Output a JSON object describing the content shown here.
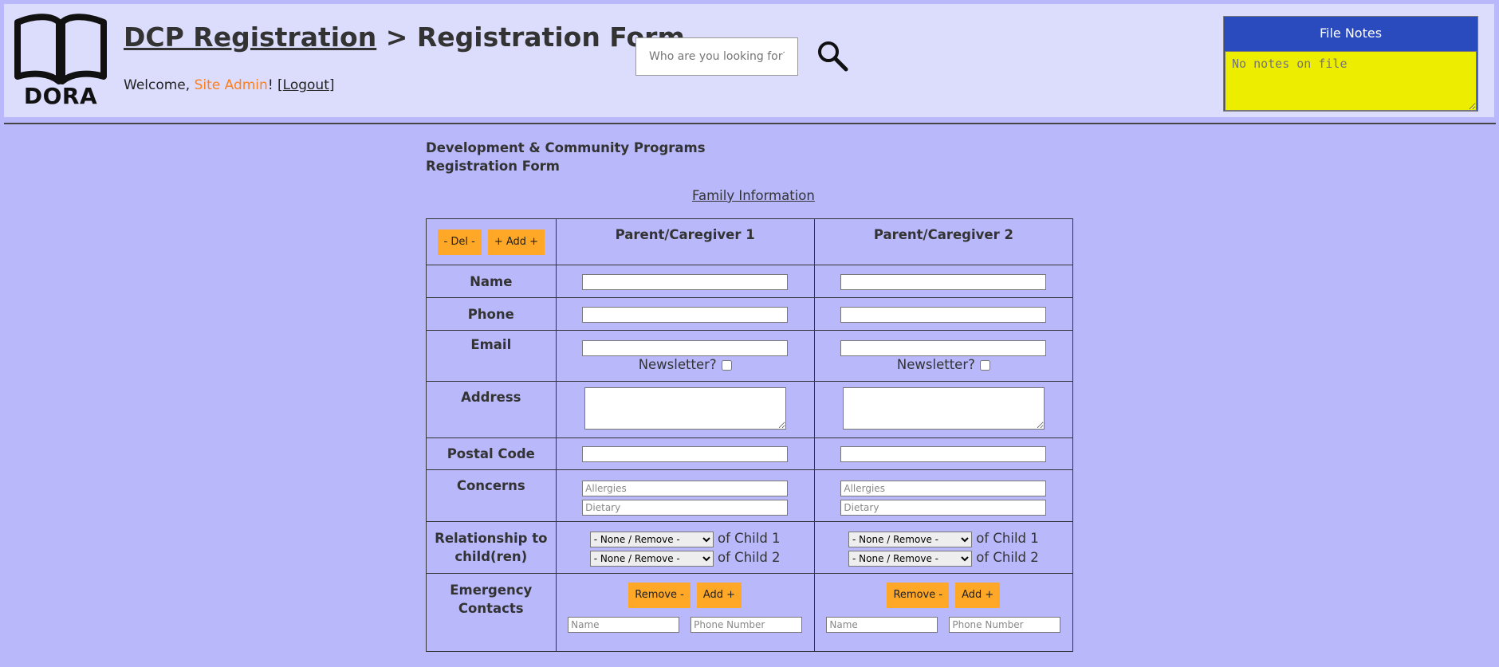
{
  "header": {
    "logo_text": "DORA",
    "breadcrumb_link": "DCP Registration",
    "breadcrumb_sep": " > ",
    "breadcrumb_current": "Registration Form",
    "welcome_prefix": "Welcome, ",
    "user_name": "Site Admin",
    "welcome_mid": "! [",
    "logout_label": "Logout",
    "welcome_suffix": "]",
    "search_placeholder": "Who are you looking for?",
    "search_icon": "search-icon"
  },
  "notes": {
    "title": "File Notes",
    "placeholder": "No notes on file"
  },
  "org": {
    "line1": "Development & Community Programs",
    "line2": "Registration Form"
  },
  "section_title": "Family Information",
  "table": {
    "del_label": "- Del -",
    "add_label": "+ Add +",
    "columns": [
      "Parent/Caregiver 1",
      "Parent/Caregiver 2"
    ],
    "rows": {
      "name": "Name",
      "phone": "Phone",
      "email": "Email",
      "address": "Address",
      "postal": "Postal Code",
      "concerns": "Concerns",
      "relationship": "Relationship to child(ren)",
      "emergency": "Emergency Contacts"
    },
    "newsletter_label": "Newsletter?",
    "allergies_placeholder": "Allergies",
    "dietary_placeholder": "Dietary",
    "relationship_option": "- None / Remove -",
    "of_child_1": "of Child 1",
    "of_child_2": "of Child 2",
    "remove_label": "Remove -",
    "add_contact_label": "Add +",
    "contact_name_placeholder": "Name",
    "contact_phone_placeholder": "Phone Number"
  }
}
